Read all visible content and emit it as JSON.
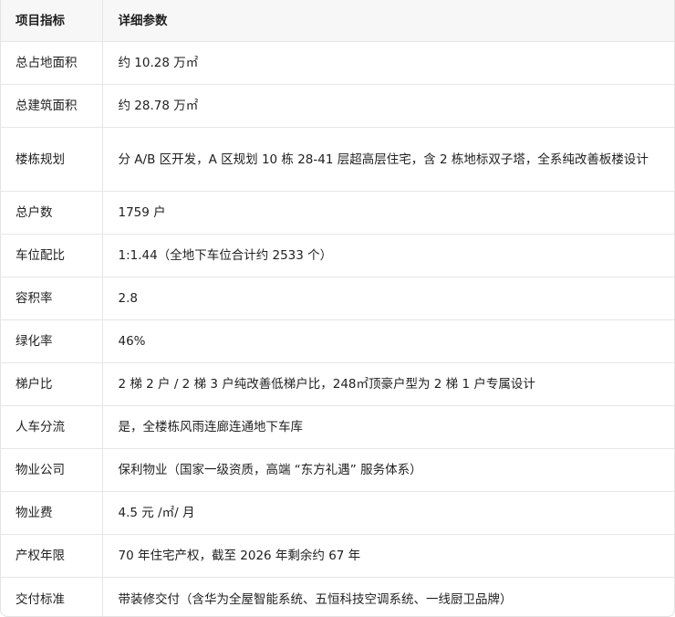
{
  "table": {
    "headers": [
      "项目指标",
      "详细参数"
    ],
    "rows": [
      {
        "label": "总占地面积",
        "value": "约 10.28 万㎡"
      },
      {
        "label": "总建筑面积",
        "value": "约 28.78 万㎡"
      },
      {
        "label": "楼栋规划",
        "value": "分 A/B 区开发，A 区规划 10 栋 28-41 层超高层住宅，含 2 栋地标双子塔，全系纯改善板楼设计"
      },
      {
        "label": "总户数",
        "value": "1759 户"
      },
      {
        "label": "车位配比",
        "value": "1:1.44（全地下车位合计约 2533 个）"
      },
      {
        "label": "容积率",
        "value": "2.8"
      },
      {
        "label": "绿化率",
        "value": "46%"
      },
      {
        "label": "梯户比",
        "value": "2 梯 2 户 / 2 梯 3 户纯改善低梯户比，248㎡顶豪户型为 2 梯 1 户专属设计"
      },
      {
        "label": "人车分流",
        "value": "是，全楼栋风雨连廊连通地下车库"
      },
      {
        "label": "物业公司",
        "value": "保利物业（国家一级资质，高端 “东方礼遇” 服务体系）"
      },
      {
        "label": "物业费",
        "value": "4.5 元 /㎡/ 月"
      },
      {
        "label": "产权年限",
        "value": "70 年住宅产权，截至 2026 年剩余约 67 年"
      },
      {
        "label": "交付标准",
        "value": "带装修交付（含华为全屋智能系统、五恒科技空调系统、一线厨卫品牌）"
      }
    ]
  }
}
